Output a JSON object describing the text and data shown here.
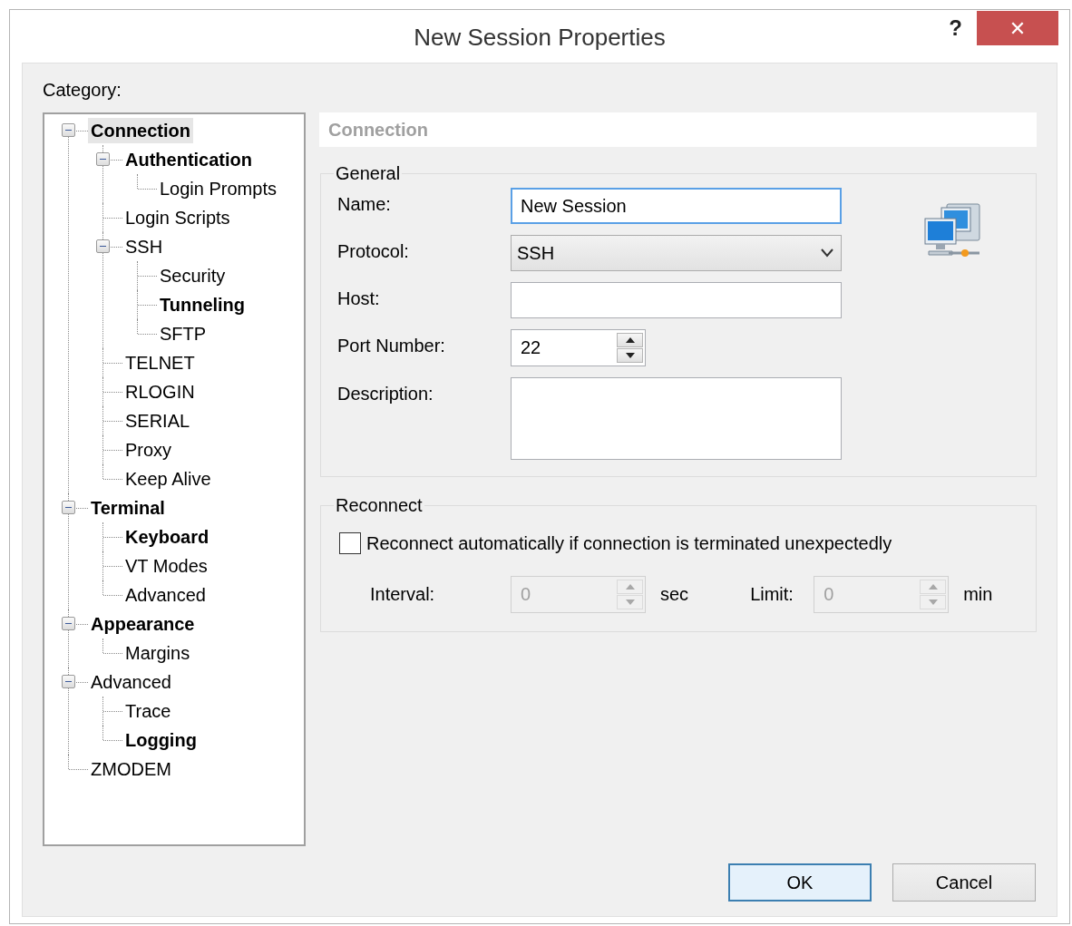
{
  "window": {
    "title": "New Session Properties",
    "help_button": "?",
    "close_button": "✕"
  },
  "category_label": "Category:",
  "tree": [
    {
      "label": "Connection",
      "bold": true,
      "selected": true,
      "expanded": true,
      "children": [
        {
          "label": "Authentication",
          "bold": true,
          "selected": false,
          "expanded": true,
          "children": [
            {
              "label": "Login Prompts",
              "bold": false,
              "selected": false
            }
          ]
        },
        {
          "label": "Login Scripts",
          "bold": false,
          "selected": false
        },
        {
          "label": "SSH",
          "bold": false,
          "selected": false,
          "expanded": true,
          "children": [
            {
              "label": "Security",
              "bold": false,
              "selected": false
            },
            {
              "label": "Tunneling",
              "bold": true,
              "selected": false
            },
            {
              "label": "SFTP",
              "bold": false,
              "selected": false
            }
          ]
        },
        {
          "label": "TELNET",
          "bold": false,
          "selected": false
        },
        {
          "label": "RLOGIN",
          "bold": false,
          "selected": false
        },
        {
          "label": "SERIAL",
          "bold": false,
          "selected": false
        },
        {
          "label": "Proxy",
          "bold": false,
          "selected": false
        },
        {
          "label": "Keep Alive",
          "bold": false,
          "selected": false
        }
      ]
    },
    {
      "label": "Terminal",
      "bold": true,
      "selected": false,
      "expanded": true,
      "children": [
        {
          "label": "Keyboard",
          "bold": true,
          "selected": false
        },
        {
          "label": "VT Modes",
          "bold": false,
          "selected": false
        },
        {
          "label": "Advanced",
          "bold": false,
          "selected": false
        }
      ]
    },
    {
      "label": "Appearance",
      "bold": true,
      "selected": false,
      "expanded": true,
      "children": [
        {
          "label": "Margins",
          "bold": false,
          "selected": false
        }
      ]
    },
    {
      "label": "Advanced",
      "bold": false,
      "selected": false,
      "expanded": true,
      "children": [
        {
          "label": "Trace",
          "bold": false,
          "selected": false
        },
        {
          "label": "Logging",
          "bold": true,
          "selected": false
        }
      ]
    },
    {
      "label": "ZMODEM",
      "bold": false,
      "selected": false
    }
  ],
  "page_header": "Connection",
  "general": {
    "title": "General",
    "fields": [
      {
        "kind": "text",
        "label": "Name:",
        "value": "New Session",
        "focused": true
      },
      {
        "kind": "select",
        "label": "Protocol:",
        "value": "SSH"
      },
      {
        "kind": "text",
        "label": "Host:",
        "focused": false
      },
      {
        "kind": "spin",
        "label": "Port Number:",
        "value": "22",
        "disabled": false
      },
      {
        "kind": "textarea",
        "label": "Description:"
      }
    ]
  },
  "reconnect": {
    "title": "Reconnect",
    "checkbox": {
      "label": "Reconnect automatically if connection is terminated unexpectedly",
      "checked": false
    },
    "spins": [
      {
        "label": "Interval:",
        "value": "0",
        "unit": "sec",
        "disabled": true
      },
      {
        "label": "Limit:",
        "value": "0",
        "unit": "min",
        "disabled": true
      }
    ]
  },
  "buttons": [
    {
      "label": "OK",
      "default": true
    },
    {
      "label": "Cancel",
      "default": false
    }
  ]
}
